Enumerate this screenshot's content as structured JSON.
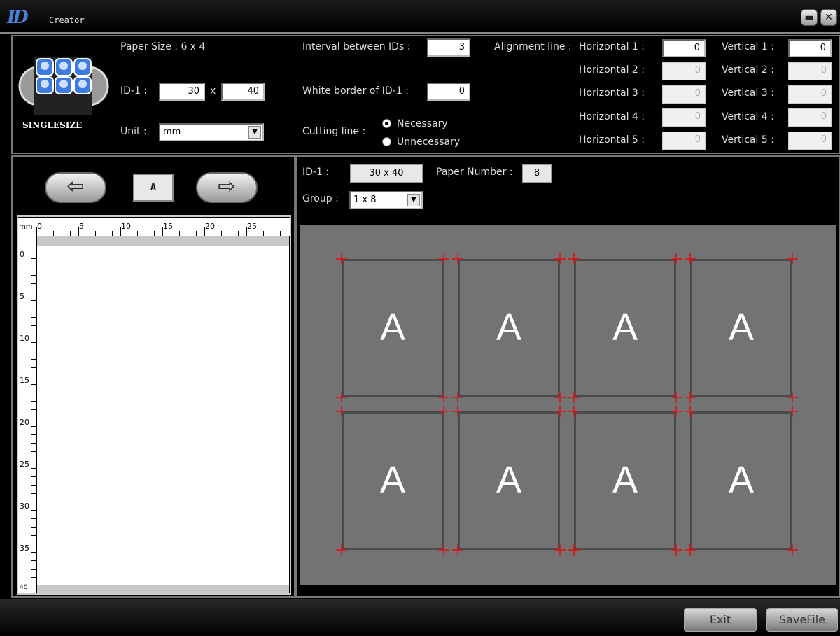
{
  "window": {
    "title": "Creator",
    "logo": "ID",
    "minimize_icon": "minimize-icon",
    "close_icon": "close-icon"
  },
  "settings": {
    "paper_size": "Paper Size : 6 x 4",
    "mode_label": "SINGLESIZE",
    "id_label": "ID-1 :",
    "id_width": "30",
    "id_x": "x",
    "id_height": "40",
    "unit_label": "Unit :",
    "unit_value": "mm",
    "interval_label": "Interval between IDs :",
    "interval_value": "3",
    "white_border_label": "White border of ID-1 :",
    "white_border_value": "0",
    "cutting_label": "Cutting line :",
    "cutting_options": [
      "Necessary",
      "Unnecessary"
    ],
    "cutting_selected": "Necessary",
    "alignment_label": "Alignment line :",
    "horizontal": [
      {
        "label": "Horizontal 1 :",
        "value": "0"
      },
      {
        "label": "Horizontal 2 :",
        "value": "0"
      },
      {
        "label": "Horizontal 3 :",
        "value": "0"
      },
      {
        "label": "Horizontal 4 :",
        "value": "0"
      },
      {
        "label": "Horizontal 5 :",
        "value": "0"
      }
    ],
    "vertical": [
      {
        "label": "Vertical 1 :",
        "value": "0"
      },
      {
        "label": "Vertical 2 :",
        "value": "0"
      },
      {
        "label": "Vertical 3 :",
        "value": "0"
      },
      {
        "label": "Vertical 4 :",
        "value": "0"
      },
      {
        "label": "Vertical 5 :",
        "value": "0"
      }
    ]
  },
  "editor": {
    "prev_glyph": "⇦",
    "next_glyph": "⇨",
    "current_page": "A",
    "ruler_unit": "mm",
    "ruler_h": [
      "0",
      "5",
      "10",
      "15",
      "20",
      "25"
    ],
    "ruler_v": [
      "0",
      "5",
      "10",
      "15",
      "20",
      "25",
      "30",
      "35",
      "40"
    ]
  },
  "layout_info": {
    "id_label": "ID-1 :",
    "id_value": "30 x 40",
    "paper_number_label": "Paper Number :",
    "paper_number_value": "8",
    "group_label": "Group :",
    "group_value": "1 x 8"
  },
  "preview": {
    "card_letters": [
      "A",
      "A",
      "A",
      "A",
      "A",
      "A",
      "A",
      "A"
    ]
  },
  "footer": {
    "exit_label": "Exit",
    "save_label": "SaveFile"
  }
}
